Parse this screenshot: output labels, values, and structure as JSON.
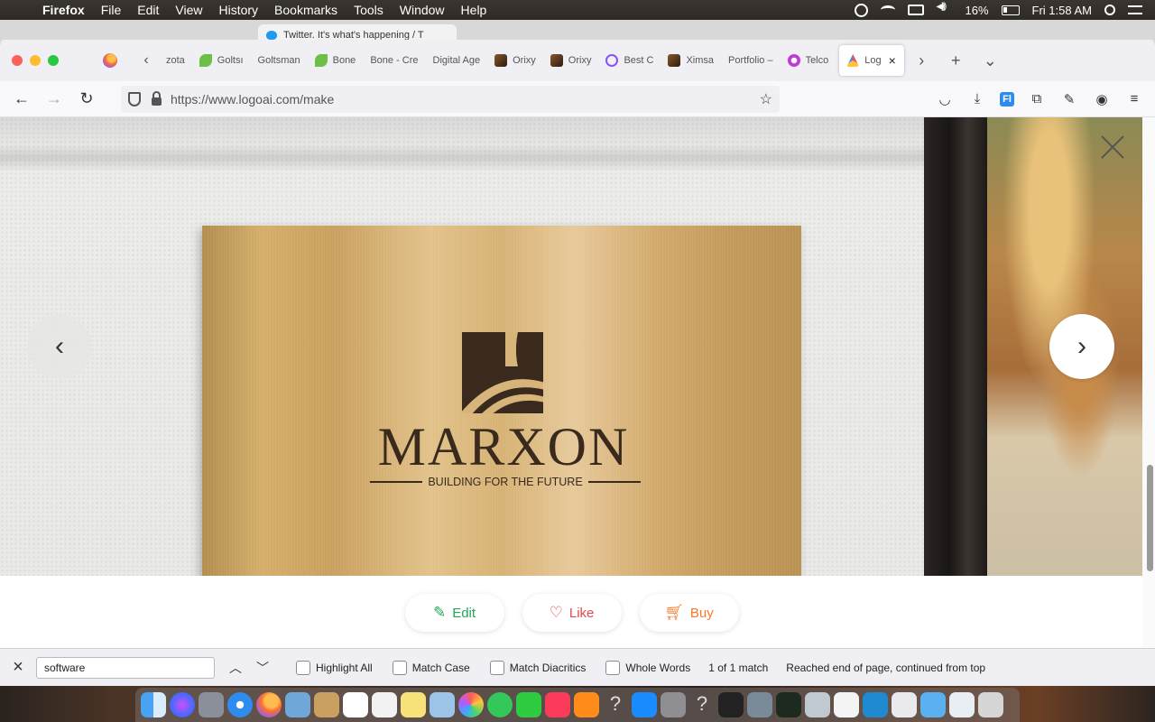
{
  "menubar": {
    "app": "Firefox",
    "items": [
      "File",
      "Edit",
      "View",
      "History",
      "Bookmarks",
      "Tools",
      "Window",
      "Help"
    ],
    "battery": "16%",
    "clock": "Fri 1:58 AM"
  },
  "background_window": {
    "tab_title": "Twitter. It's what's happening / T"
  },
  "tabs": [
    {
      "label": "zota",
      "icon": "none"
    },
    {
      "label": "Goltsı",
      "icon": "leaf"
    },
    {
      "label": "Goltsman",
      "icon": "none"
    },
    {
      "label": "Bone",
      "icon": "leaf"
    },
    {
      "label": "Bone - Cre",
      "icon": "none"
    },
    {
      "label": "Digital Age",
      "icon": "none"
    },
    {
      "label": "Orixy",
      "icon": "photo"
    },
    {
      "label": "Orixy",
      "icon": "photo"
    },
    {
      "label": "Best C",
      "icon": "swirl"
    },
    {
      "label": "Ximsa",
      "icon": "photo"
    },
    {
      "label": "Portfolio –",
      "icon": "none"
    },
    {
      "label": "Telco",
      "icon": "telco"
    }
  ],
  "active_tab": {
    "label": "Log",
    "icon": "logo"
  },
  "address": {
    "url": "https://www.logoai.com/make"
  },
  "mockup": {
    "brand_name": "MARXON",
    "tagline": "BUILDING FOR THE FUTURE"
  },
  "nav": {
    "prev": "‹",
    "next": "›"
  },
  "actions": {
    "edit": "Edit",
    "like": "Like",
    "buy": "Buy"
  },
  "findbar": {
    "query": "software",
    "highlight_all": "Highlight All",
    "match_case": "Match Case",
    "match_diacritics": "Match Diacritics",
    "whole_words": "Whole Words",
    "match_count": "1 of 1 match",
    "status": "Reached end of page, continued from top"
  },
  "colors": {
    "edit": "#23a55a",
    "like": "#e5484d",
    "buy": "#f47b2a",
    "brand_text": "#3a2a1e",
    "plaque_gold": "#d4ae6a"
  }
}
